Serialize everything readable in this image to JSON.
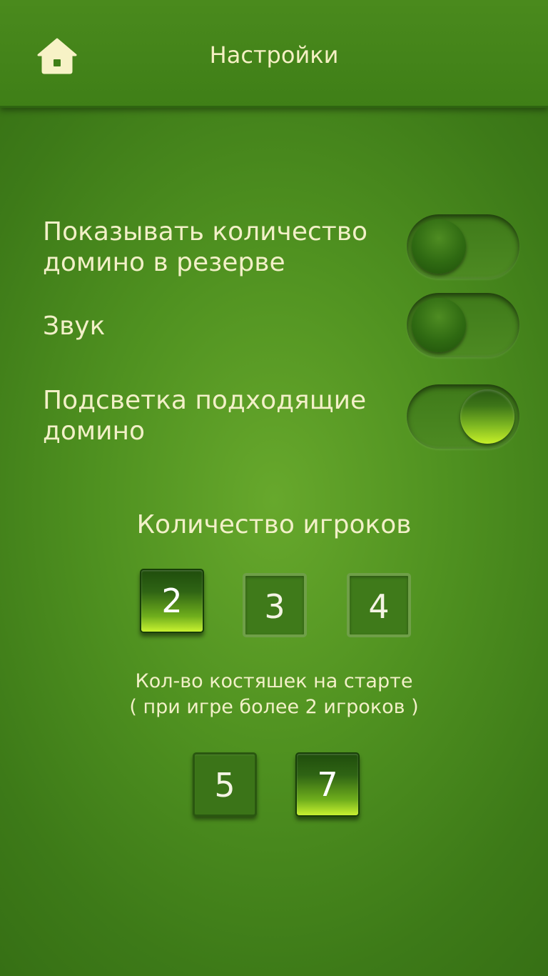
{
  "header": {
    "title": "Настройки",
    "home_icon": "home-icon"
  },
  "settings": [
    {
      "label": "Показывать количество домино в резерве",
      "enabled": false
    },
    {
      "label": "Звук",
      "enabled": false
    },
    {
      "label": "Подсветка подходящие домино",
      "enabled": true
    }
  ],
  "players": {
    "title": "Количество игроков",
    "options": [
      "2",
      "3",
      "4"
    ],
    "selected": "2"
  },
  "start_tiles": {
    "title_line1": "Кол-во костяшек на старте",
    "title_line2": "( при игре более 2 игроков )",
    "options": [
      "5",
      "7"
    ],
    "selected": "7"
  },
  "colors": {
    "background": "#4f9120",
    "text": "#f2f0c8",
    "accent": "#c8f230"
  }
}
